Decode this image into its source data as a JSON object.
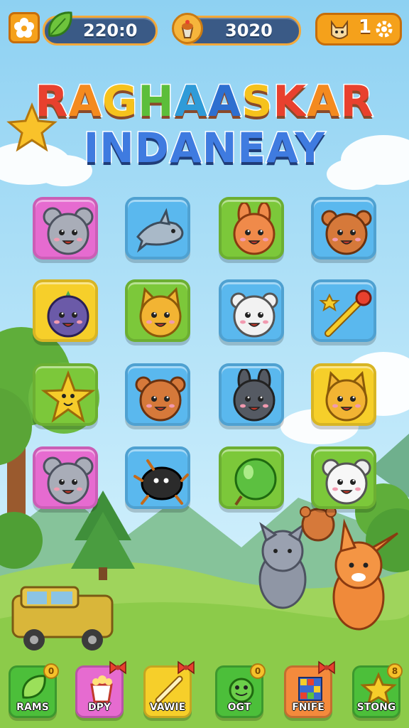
{
  "top_bar": {
    "menu_icon": "flower-icon",
    "leaf_counter": "220:0",
    "cup_counter": "3020",
    "profile_level": "1",
    "colors": {
      "pill_bg": "#3a5a86",
      "pill_border": "#f3a93a",
      "button": "#f5a11b"
    }
  },
  "title": {
    "line1": [
      "R",
      "A",
      "G",
      "H",
      "A",
      "A",
      "S",
      "K",
      "A",
      "R"
    ],
    "line1_colors": [
      "#e8412e",
      "#f48a1f",
      "#f6c21d",
      "#5cbe3a",
      "#2f9bd8",
      "#2e6fd0",
      "#f6c21d",
      "#e8412e",
      "#f48a1f",
      "#e8412e"
    ],
    "line2": "INDANEAY"
  },
  "grid": {
    "tiles": [
      {
        "animal": "mouse",
        "color": "#e66bd0",
        "icon": "mouse-icon"
      },
      {
        "animal": "dolphin",
        "color": "#5ab8ee",
        "icon": "dolphin-icon"
      },
      {
        "animal": "bunny",
        "color": "#7cc83a",
        "icon": "bunny-icon"
      },
      {
        "animal": "bear",
        "color": "#5ab8ee",
        "icon": "bear-icon"
      },
      {
        "animal": "purple-blob",
        "color": "#f6cf2a",
        "icon": "purple-creature-icon"
      },
      {
        "animal": "fox",
        "color": "#7cc83a",
        "icon": "fox-icon"
      },
      {
        "animal": "white-bear",
        "color": "#5ab8ee",
        "icon": "white-bear-icon"
      },
      {
        "animal": "magic-wand",
        "color": "#5ab8ee",
        "icon": "wand-icon"
      },
      {
        "animal": "star",
        "color": "#7cc83a",
        "icon": "star-icon"
      },
      {
        "animal": "bear",
        "color": "#5ab8ee",
        "icon": "bear-icon"
      },
      {
        "animal": "grey-bunny",
        "color": "#5ab8ee",
        "icon": "grey-bunny-icon"
      },
      {
        "animal": "fox",
        "color": "#f6cf2a",
        "icon": "fox-icon"
      },
      {
        "animal": "mouse",
        "color": "#e66bd0",
        "icon": "mouse-icon"
      },
      {
        "animal": "black-bug",
        "color": "#5ab8ee",
        "icon": "bug-icon"
      },
      {
        "animal": "balloon",
        "color": "#7cc83a",
        "icon": "balloon-icon"
      },
      {
        "animal": "white-mouse",
        "color": "#7cc83a",
        "icon": "white-mouse-icon"
      }
    ]
  },
  "bottom_bar": {
    "buttons": [
      {
        "label": "RAMS",
        "color": "#4cbf3a",
        "icon": "leaf-icon",
        "badge": "0"
      },
      {
        "label": "DPY",
        "color": "#e66bd0",
        "icon": "popcorn-icon",
        "badge": ""
      },
      {
        "label": "VAWIE",
        "color": "#f6cf2a",
        "icon": "pencil-icon",
        "badge": ""
      },
      {
        "label": "OGT",
        "color": "#4cbf3a",
        "icon": "frog-icon",
        "badge": "0"
      },
      {
        "label": "FNIFE",
        "color": "#f48a3c",
        "icon": "puzzle-icon",
        "badge": ""
      },
      {
        "label": "STONG",
        "color": "#4cbf3a",
        "icon": "star-icon",
        "badge": "8"
      }
    ]
  }
}
